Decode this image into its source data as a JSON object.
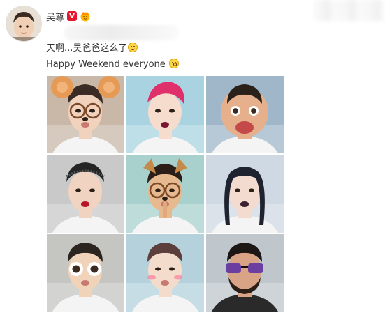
{
  "post": {
    "author": "吴尊",
    "verified_icon": "verified-v-badge",
    "level_icon": "fan-crown-icon",
    "text_line1": "天啊...吴爸爸这么了",
    "text_line1_emoji": "grin-emoji",
    "text_line2": "Happy Weekend everyone",
    "text_line2_emoji": "surprised-emoji"
  },
  "photos": [
    {
      "name": "photo-bear-filter",
      "bg": "#c9b8a8",
      "skin": "#f1d2bd",
      "hair": "#3a2c25",
      "accent": "#e59a55",
      "filter": "bear-ears"
    },
    {
      "name": "photo-pink-hair-filter",
      "bg": "#a9d3e0",
      "skin": "#f5dccd",
      "hair": "#e0306b",
      "accent": "#7a1530",
      "filter": "pink-hair"
    },
    {
      "name": "photo-big-face-filter",
      "bg": "#9fb7c9",
      "skin": "#e6b08c",
      "hair": "#2b211b",
      "accent": "#c44a4a",
      "filter": "big-eyes-lips"
    },
    {
      "name": "photo-red-lips-filter",
      "bg": "#c9c9c9",
      "skin": "#f0d4c1",
      "hair": "#242424",
      "accent": "#b5162a",
      "filter": "red-lips"
    },
    {
      "name": "photo-dog-glasses-filter",
      "bg": "#a8d0cd",
      "skin": "#e7b98e",
      "hair": "#2a1e16",
      "accent": "#c58a4a",
      "filter": "dog-glasses"
    },
    {
      "name": "photo-dark-lips-filter",
      "bg": "#cfd9e3",
      "skin": "#f3dccf",
      "hair": "#1f2330",
      "accent": "#3b2030",
      "filter": "dark-lips"
    },
    {
      "name": "photo-big-eyes-filter",
      "bg": "#c5c5c2",
      "skin": "#f0d3b8",
      "hair": "#2b241f",
      "accent": "#d67575",
      "filter": "big-eyes"
    },
    {
      "name": "photo-blush-filter",
      "bg": "#b5d2dc",
      "skin": "#f4dccc",
      "hair": "#5c3e3a",
      "accent": "#ff7fa0",
      "filter": "blush"
    },
    {
      "name": "photo-sunglasses-beard-filter",
      "bg": "#bfc6cc",
      "skin": "#d9a486",
      "hair": "#1c1714",
      "accent": "#6b3fa0",
      "filter": "sunglasses-beard"
    }
  ]
}
